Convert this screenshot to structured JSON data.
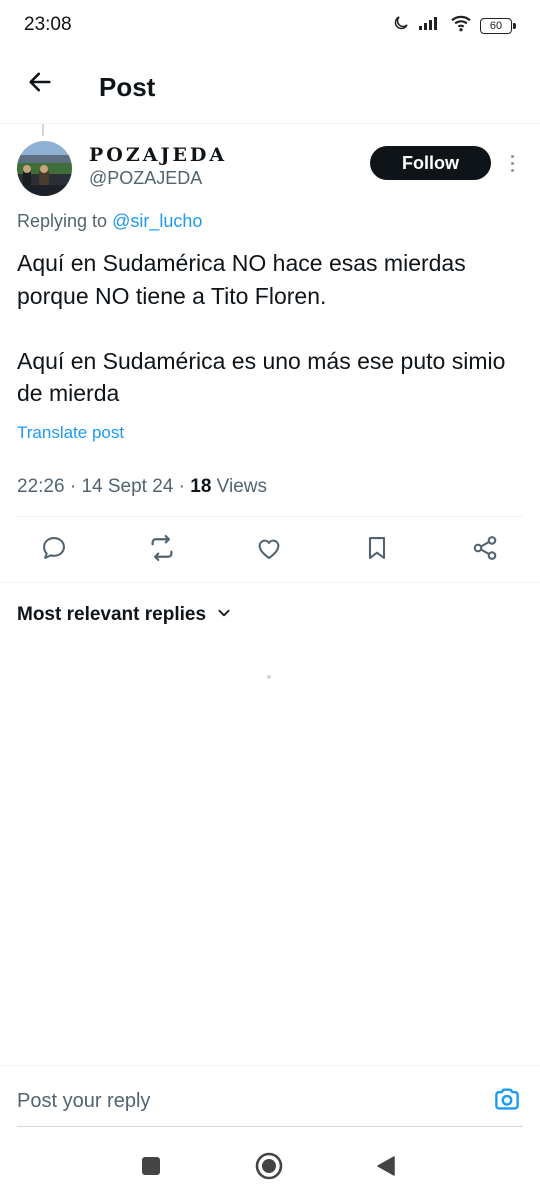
{
  "status_bar": {
    "time": "23:08",
    "battery": "60",
    "icons": [
      "moon-icon",
      "signal-icon",
      "wifi-icon",
      "battery-icon"
    ]
  },
  "header": {
    "title": "Post",
    "back_icon": "arrow-left-icon"
  },
  "post": {
    "author": {
      "display_name": "POZAJEDA",
      "handle": "@POZAJEDA"
    },
    "follow_label": "Follow",
    "replying_prefix": "Replying to ",
    "replying_to": "@sir_lucho",
    "paragraphs": [
      "Aquí en Sudamérica NO hace esas mierdas porque NO tiene a Tito Floren.",
      "Aquí en Sudamérica es uno más ese puto simio de mierda"
    ],
    "translate_label": "Translate post",
    "time": "22:26",
    "date": "14 Sept 24",
    "views_count": "18",
    "views_label": "Views",
    "actions": [
      "reply-icon",
      "retweet-icon",
      "like-icon",
      "bookmark-icon",
      "share-icon"
    ]
  },
  "replies": {
    "sort_label": "Most relevant replies"
  },
  "composer": {
    "placeholder": "Post your reply"
  },
  "colors": {
    "accent": "#1d9bf0",
    "text_primary": "#0f1419",
    "text_secondary": "#536471",
    "follow_bg": "#0f1419"
  }
}
